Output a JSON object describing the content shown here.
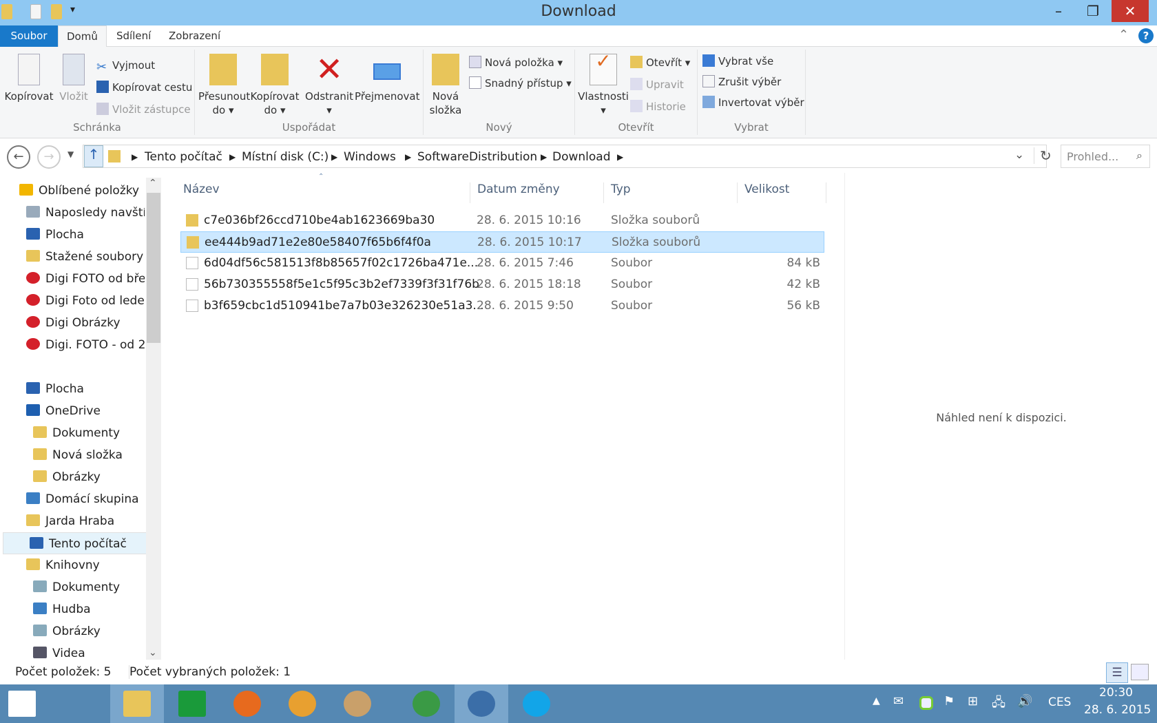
{
  "window": {
    "title": "Download"
  },
  "tabs": [
    "Soubor",
    "Domů",
    "Sdílení",
    "Zobrazení"
  ],
  "ribbon": {
    "clipboard": {
      "label": "Schránka",
      "copy": "Kopírovat",
      "paste": "Vložit",
      "cut": "Vyjmout",
      "copy_path": "Kopírovat cestu",
      "paste_shortcut": "Vložit zástupce"
    },
    "organize": {
      "label": "Uspořádat",
      "move_to": "Přesunout",
      "copy_to": "Kopírovat",
      "to": "do",
      "delete": "Odstranit",
      "rename": "Přejmenovat"
    },
    "new": {
      "label": "Nový",
      "new_folder_1": "Nová",
      "new_folder_2": "složka",
      "new_item": "Nová položka",
      "easy_access": "Snadný přístup"
    },
    "open": {
      "label": "Otevřít",
      "properties": "Vlastnosti",
      "open": "Otevřít",
      "edit": "Upravit",
      "history": "Historie"
    },
    "select": {
      "label": "Vybrat",
      "select_all": "Vybrat vše",
      "select_none": "Zrušit výběr",
      "invert": "Invertovat výběr"
    }
  },
  "address": {
    "crumbs": [
      "Tento počítač",
      "Místní disk (C:)",
      "Windows",
      "SoftwareDistribution",
      "Download"
    ],
    "search_placeholder": "Prohled..."
  },
  "nav": [
    {
      "label": "Oblíbené položky",
      "indent": 0,
      "color": "#f2b600"
    },
    {
      "label": "Naposledy navštívené",
      "indent": 1,
      "color": "#9ab"
    },
    {
      "label": "Plocha",
      "indent": 1,
      "color": "#2a62b0"
    },
    {
      "label": "Stažené soubory",
      "indent": 1,
      "color": "#e8c55a"
    },
    {
      "label": "Digi FOTO od března",
      "indent": 1,
      "color": "#d4202a"
    },
    {
      "label": "Digi Foto od ledena",
      "indent": 1,
      "color": "#d4202a"
    },
    {
      "label": "Digi Obrázky",
      "indent": 1,
      "color": "#d4202a"
    },
    {
      "label": "Digi. FOTO - od 2",
      "indent": 1,
      "color": "#d4202a"
    },
    {
      "label": "",
      "indent": 0,
      "color": ""
    },
    {
      "label": "Plocha",
      "indent": 1,
      "color": "#2a62b0"
    },
    {
      "label": "OneDrive",
      "indent": 1,
      "color": "#1e5fb0"
    },
    {
      "label": "Dokumenty",
      "indent": 2,
      "color": "#e8c55a"
    },
    {
      "label": "Nová složka",
      "indent": 2,
      "color": "#e8c55a"
    },
    {
      "label": "Obrázky",
      "indent": 2,
      "color": "#e8c55a"
    },
    {
      "label": "Domácí skupina",
      "indent": 1,
      "color": "#3b7fc4"
    },
    {
      "label": "Jarda Hraba",
      "indent": 1,
      "color": "#e8c55a"
    },
    {
      "label": "Tento počítač",
      "indent": 1,
      "color": "#2a62b0",
      "selected": true
    },
    {
      "label": "Knihovny",
      "indent": 1,
      "color": "#e8c55a"
    },
    {
      "label": "Dokumenty",
      "indent": 2,
      "color": "#8ab"
    },
    {
      "label": "Hudba",
      "indent": 2,
      "color": "#3b7fc4"
    },
    {
      "label": "Obrázky",
      "indent": 2,
      "color": "#8ab"
    },
    {
      "label": "Videa",
      "indent": 2,
      "color": "#556"
    }
  ],
  "columns": [
    "Název",
    "Datum změny",
    "Typ",
    "Velikost"
  ],
  "files": [
    {
      "name": "c7e036bf26ccd710be4ab1623669ba30",
      "date": "28. 6. 2015 10:16",
      "type": "Složka souborů",
      "size": "",
      "folder": true
    },
    {
      "name": "ee444b9ad71e2e80e58407f65b6f4f0a",
      "date": "28. 6. 2015 10:17",
      "type": "Složka souborů",
      "size": "",
      "folder": true,
      "selected": true
    },
    {
      "name": "6d04df56c581513f8b85657f02c1726ba471e...",
      "date": "28. 6. 2015 7:46",
      "type": "Soubor",
      "size": "84 kB"
    },
    {
      "name": "56b730355558f5e1c5f95c3b2ef7339f3f31f76b",
      "date": "28. 6. 2015 18:18",
      "type": "Soubor",
      "size": "42 kB"
    },
    {
      "name": "b3f659cbc1d510941be7a7b03e326230e51a3...",
      "date": "28. 6. 2015 9:50",
      "type": "Soubor",
      "size": "56 kB"
    }
  ],
  "preview": {
    "text": "Náhled není k dispozici."
  },
  "status": {
    "count": "Počet položek: 5",
    "selected": "Počet vybraných položek: 1"
  },
  "tray": {
    "lang": "CES",
    "time": "20:30",
    "date": "28. 6. 2015"
  },
  "taskbar_apps": [
    {
      "name": "start",
      "color": "#ffffff"
    },
    {
      "name": "file-explorer",
      "color": "#e8c55a"
    },
    {
      "name": "store",
      "color": "#1a9a3a"
    },
    {
      "name": "firefox",
      "color": "#e76a1e"
    },
    {
      "name": "mail-client",
      "color": "#e8a030"
    },
    {
      "name": "paint",
      "color": "#c9a06a"
    },
    {
      "name": "chrome",
      "color": "#3a9a45"
    },
    {
      "name": "thunderbird",
      "color": "#3b6ea8"
    },
    {
      "name": "skype",
      "color": "#12a5e8"
    }
  ]
}
